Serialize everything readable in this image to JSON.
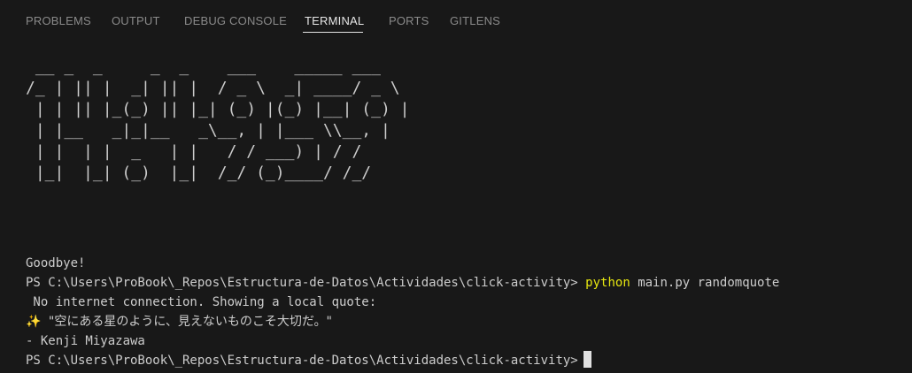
{
  "panel": {
    "tabs": [
      {
        "label": "PROBLEMS",
        "active": false
      },
      {
        "label": "OUTPUT",
        "active": false
      },
      {
        "label": "DEBUG CONSOLE",
        "active": false
      },
      {
        "label": "TERMINAL",
        "active": true
      },
      {
        "label": "PORTS",
        "active": false
      },
      {
        "label": "GITLENS",
        "active": false
      }
    ]
  },
  "terminal": {
    "ascii_banner": [
      " __ _  _     _  _    ___    _____ ___",
      "/_ | || |  _| || |  / _ \\  _| ____/ _ \\",
      " | | || |_(_) || |_| (_) |(_) |__| (_) |",
      " | |__   _|_|__   _\\__, | |___ \\\\__, |",
      " | |  | |  _   | |   / / ___) | / /",
      " |_|  |_| (_)  |_|  /_/ (_)____/ /_/"
    ],
    "goodbye": "Goodbye!",
    "prompt": "PS C:\\Users\\ProBook\\_Repos\\Estructura-de-Datos\\Actividades\\click-activity>",
    "command": "python",
    "command_args": "main.py randomquote",
    "message": " No internet connection. Showing a local quote:",
    "quote_symbol": "✨",
    "quote_text": "\"空にある星のように、見えないものこそ大切だ。\"",
    "quote_author": "- Kenji Miyazawa",
    "final_prompt": "PS C:\\Users\\ProBook\\_Repos\\Estructura-de-Datos\\Actividades\\click-activity>"
  },
  "colors": {
    "background": "#181818",
    "text": "#cccccc",
    "command": "#e5e510",
    "tab_inactive": "#8a8a8a",
    "tab_active": "#e6e6e6"
  }
}
